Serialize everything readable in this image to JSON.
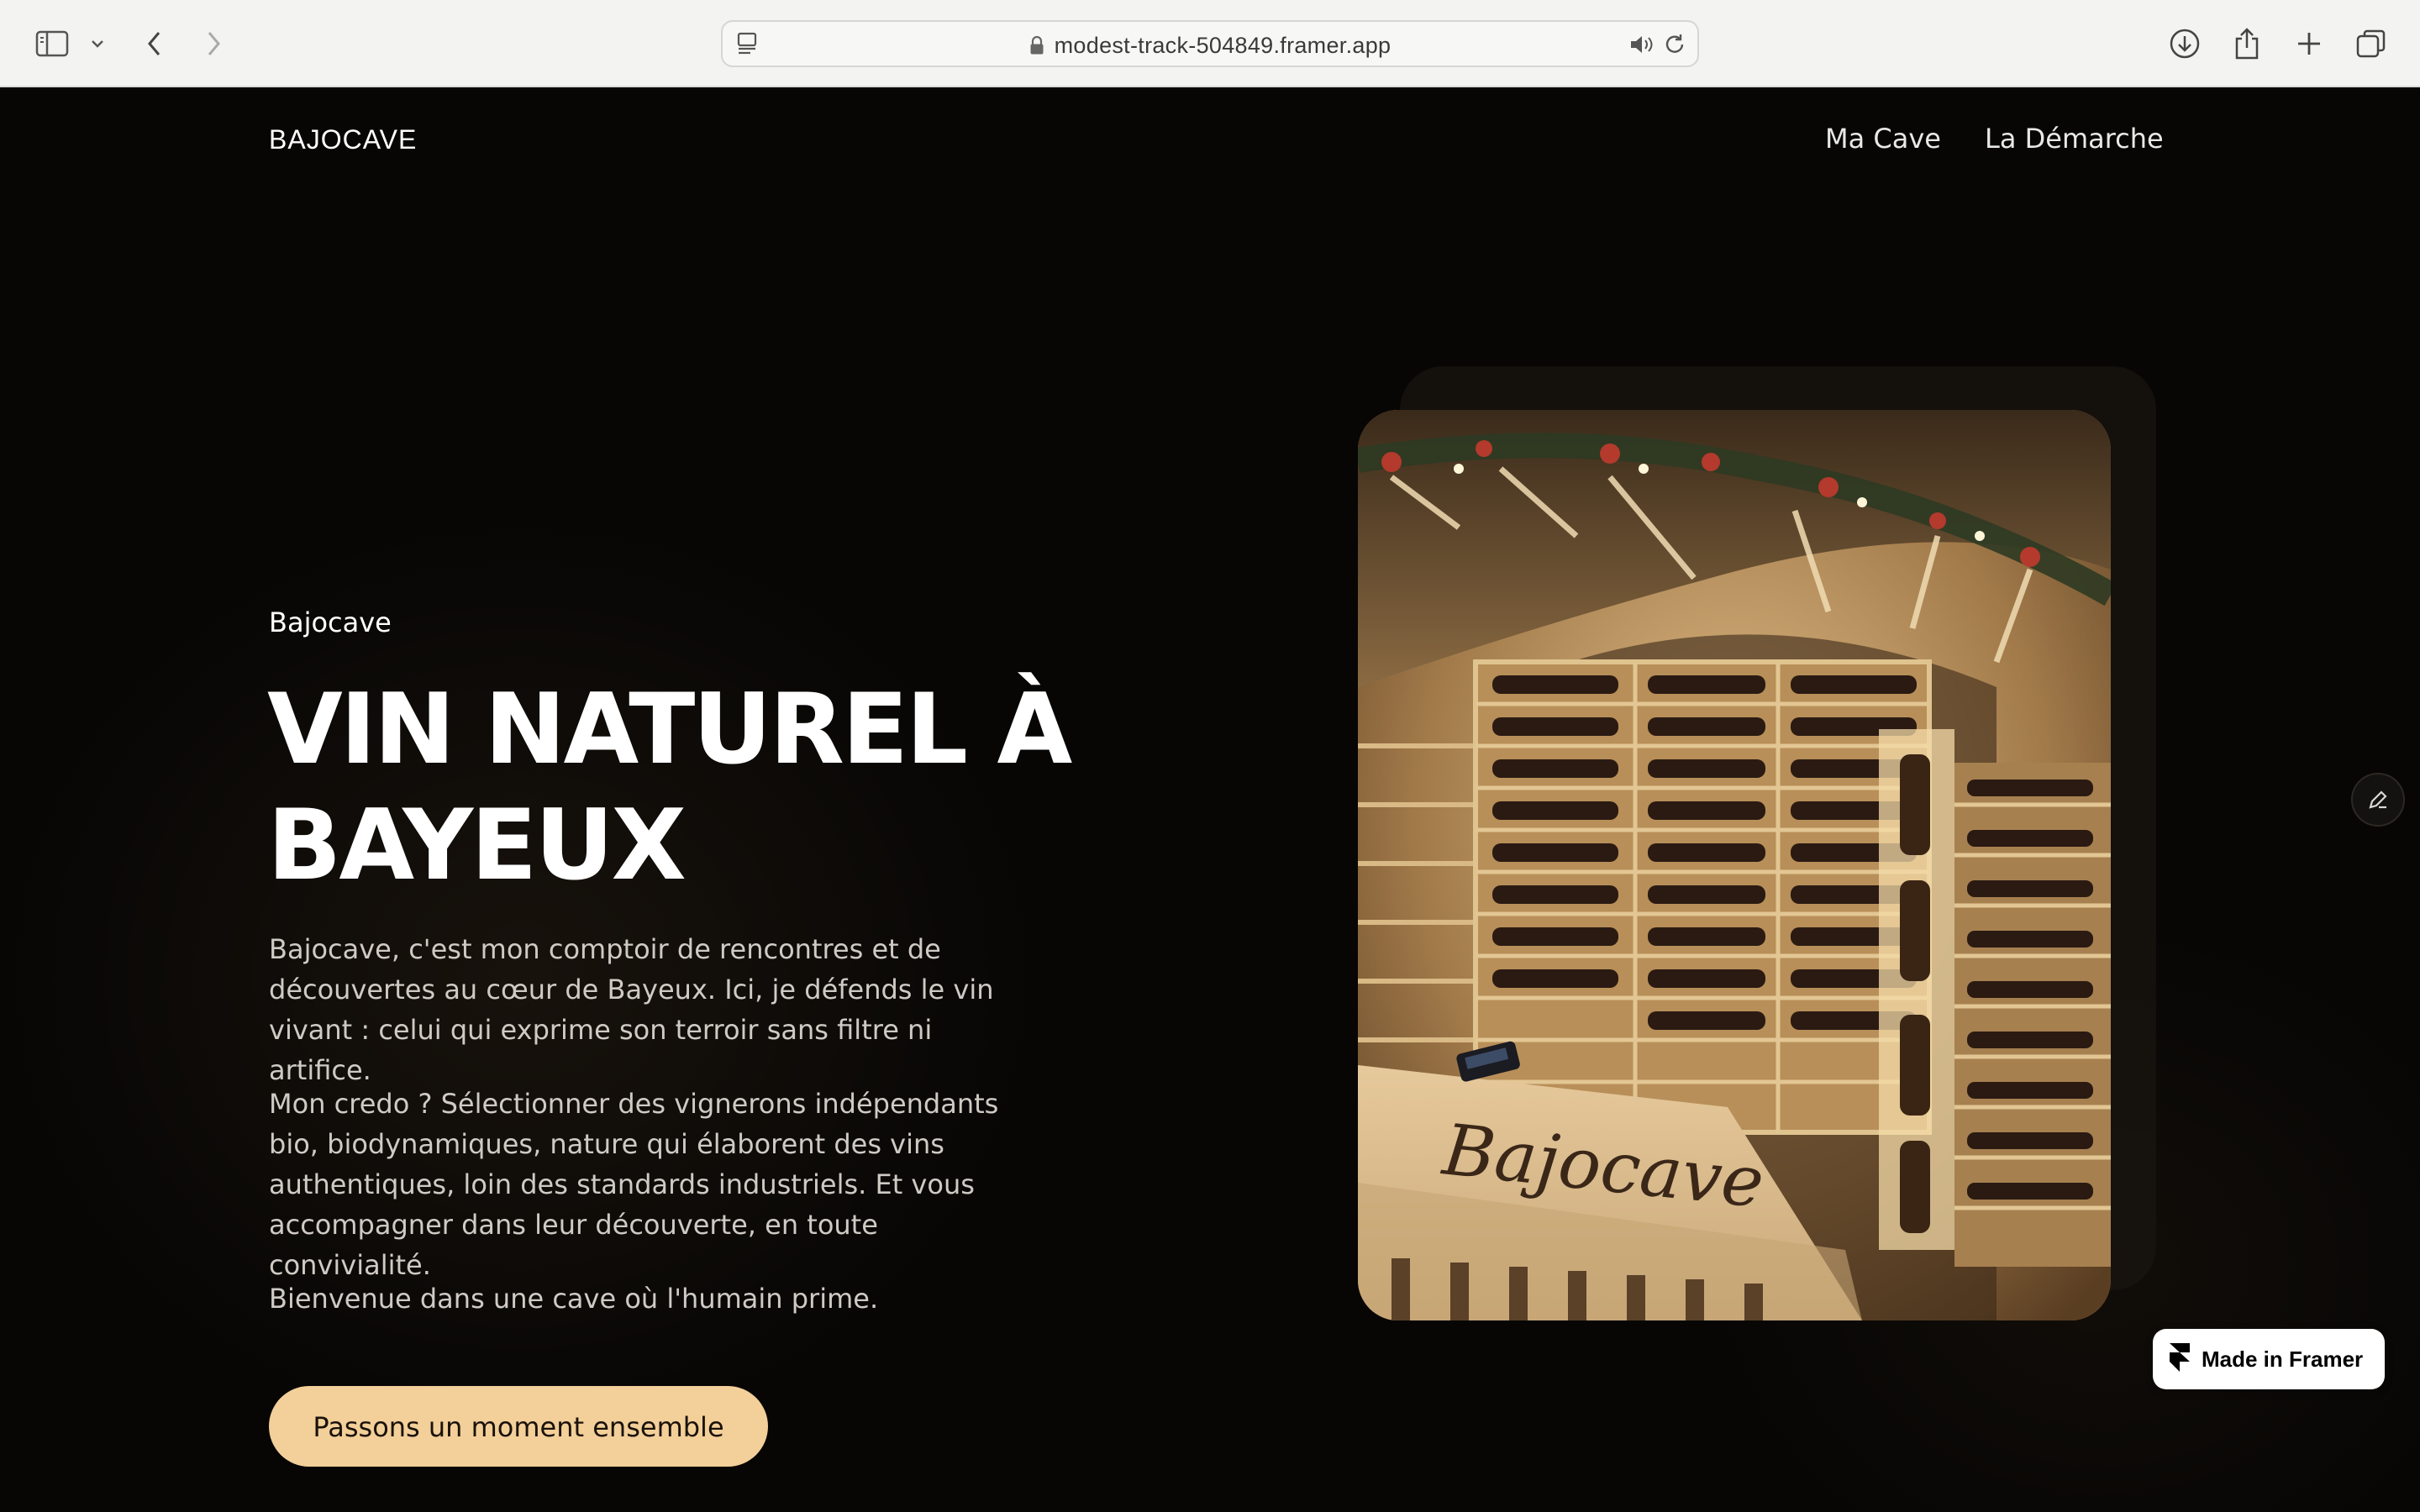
{
  "browser": {
    "url": "modest-track-504849.framer.app",
    "icons": {
      "sidebar": "sidebar-icon",
      "chevron": "chevron-down-icon",
      "back": "back-arrow-icon",
      "forward": "forward-arrow-icon",
      "tab_info": "page-info-icon",
      "lock": "lock-icon",
      "audio": "speaker-icon",
      "reload": "reload-icon",
      "download": "download-icon",
      "share": "share-icon",
      "new_tab": "plus-icon",
      "tabs": "tab-overview-icon"
    }
  },
  "header": {
    "brand": "BAJOCAVE",
    "nav": [
      "Ma Cave",
      "La Démarche"
    ]
  },
  "hero": {
    "eyebrow": "Bajocave",
    "title_line1": "VIN NATUREL À",
    "title_line2": "BAYEUX",
    "paragraphs": [
      "Bajocave, c'est mon comptoir de rencontres et de découvertes au cœur de Bayeux. Ici, je défends le vin vivant : celui qui exprime son terroir sans filtre ni artifice.",
      "Mon credo ? Sélectionner des vignerons indépendants bio, biodynamiques, nature qui élaborent des vins authentiques, loin des standards industriels. Et vous accompagner dans leur découverte, en toute convivialité.",
      "Bienvenue dans une cave où l'humain prime."
    ],
    "cta": "Passons un moment ensemble",
    "photo_counter_sign": "Bajocave"
  },
  "badge": {
    "label": "Made in Framer"
  },
  "colors": {
    "page_bg": "#070605",
    "cta_bg": "#f3cf99",
    "text_primary": "#ffffff",
    "text_body": "#cfcac4"
  }
}
